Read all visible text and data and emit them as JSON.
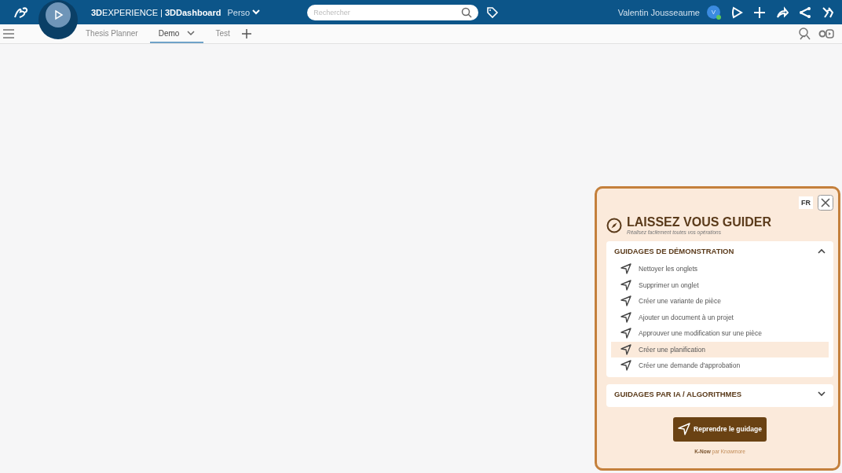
{
  "topbar": {
    "brand_bold": "3D",
    "brand": "EXPERIENCE | ",
    "app": "3DDashboard",
    "dashboard": "Perso",
    "search": {
      "placeholder": "Rechercher"
    },
    "user": "Valentin Jousseaume",
    "avatar": "V",
    "online": true
  },
  "tabs": [
    {
      "label": "Thesis Planner",
      "selected": false
    },
    {
      "label": "Demo",
      "selected": true
    },
    {
      "label": "Test",
      "selected": false
    }
  ],
  "guide_panel": {
    "language": "FR",
    "title": "LAISSEZ VOUS GUIDER",
    "subtitle": "Réalisez facilement toutes vos opérations",
    "sections": [
      {
        "title": "GUIDAGES DE DÉMONSTRATION",
        "expanded": true,
        "items": [
          {
            "label": "Nettoyer les onglets",
            "selected": false
          },
          {
            "label": "Supprimer un onglet",
            "selected": false
          },
          {
            "label": "Créer une variante de pièce",
            "selected": false
          },
          {
            "label": "Ajouter un document à un projet",
            "selected": false
          },
          {
            "label": "Approuver une modification sur une pièce",
            "selected": false
          },
          {
            "label": "Créer une planification",
            "selected": true
          },
          {
            "label": "Créer une demande d'approbation",
            "selected": false
          }
        ]
      },
      {
        "title": "GUIDAGES PAR IA / ALGORITHMES",
        "expanded": false
      }
    ],
    "resume_button": "Reprendre le guidage",
    "footer": "**K-Now** par Knowmore"
  }
}
